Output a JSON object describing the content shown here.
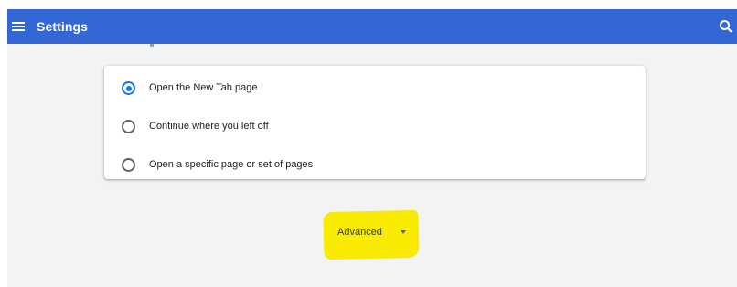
{
  "header": {
    "title": "Settings",
    "menu_icon": "hamburger-menu-icon",
    "search_icon": "search-icon",
    "background_color": "#3367d6"
  },
  "startup": {
    "options": [
      {
        "label": "Open the New Tab page",
        "selected": true
      },
      {
        "label": "Continue where you left off",
        "selected": false
      },
      {
        "label": "Open a specific page or set of pages",
        "selected": false
      }
    ]
  },
  "advanced": {
    "label": "Advanced",
    "icon": "caret-down-icon",
    "highlight_color": "#f8ea00"
  },
  "colors": {
    "accent": "#1a73e8",
    "page_background": "#f1f3f4"
  }
}
